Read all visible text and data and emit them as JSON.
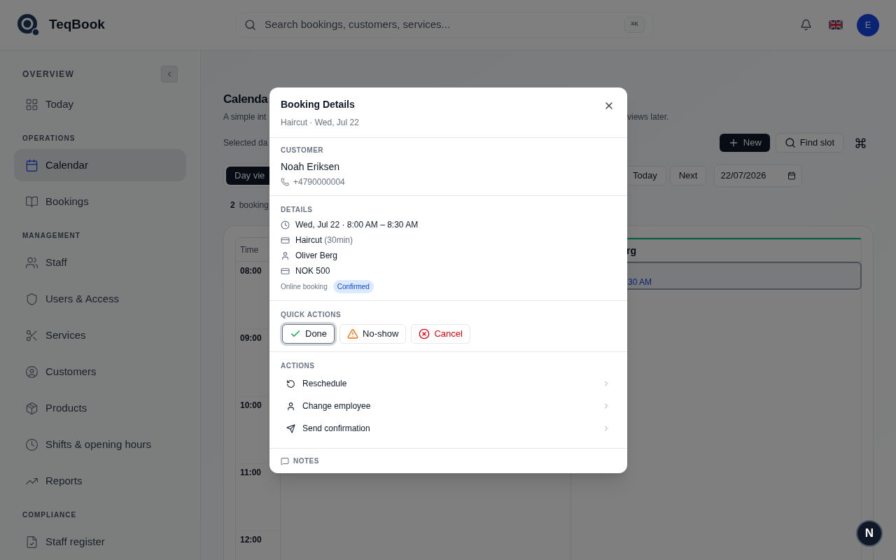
{
  "header": {
    "brand": "TeqBook",
    "search": {
      "placeholder": "Search bookings, customers, services..."
    },
    "shortcut": "⌘K",
    "avatar": "E"
  },
  "sidebar": {
    "sections": [
      {
        "label": "OVERVIEW",
        "items": [
          {
            "label": "Today",
            "selected": false
          }
        ]
      },
      {
        "label": "OPERATIONS",
        "items": [
          {
            "label": "Calendar",
            "selected": true
          },
          {
            "label": "Bookings",
            "selected": false
          }
        ]
      },
      {
        "label": "MANAGEMENT",
        "items": [
          {
            "label": "Staff",
            "selected": false
          },
          {
            "label": "Users & Access",
            "selected": false
          },
          {
            "label": "Services",
            "selected": false
          },
          {
            "label": "Customers",
            "selected": false
          },
          {
            "label": "Products",
            "selected": false
          },
          {
            "label": "Shifts & opening hours",
            "selected": false
          },
          {
            "label": "Reports",
            "selected": false
          }
        ]
      },
      {
        "label": "COMPLIANCE",
        "items": [
          {
            "label": "Staff register",
            "selected": false
          }
        ]
      }
    ]
  },
  "page": {
    "title": "Calenda",
    "subtitle_start": "A simple int",
    "subtitle_end": "views later.",
    "selected_date": "Selected da",
    "new_button": "New",
    "find_slot_button": "Find slot",
    "view_button": "Day vie",
    "today_button": "Today",
    "next_button": "Next",
    "date_value": "22/07/2026",
    "count": "2",
    "count_label": "booking",
    "calendar": {
      "time_header": "Time",
      "column_header": "rg",
      "times": [
        "08:00",
        "09:00",
        "10:00",
        "11:00",
        "12:00"
      ],
      "event_time": "30 AM"
    }
  },
  "dialog": {
    "title": "Booking Details",
    "subtitle": "Haircut · Wed, Jul 22",
    "customer": {
      "label": "CUSTOMER",
      "name": "Noah Eriksen",
      "phone": "+4790000004"
    },
    "details": {
      "label": "DETAILS",
      "rows": [
        {
          "kind": "time",
          "text": "Wed, Jul 22 · 8:00 AM – 8:30 AM"
        },
        {
          "kind": "service",
          "text": "Haircut",
          "note": "(30min)"
        },
        {
          "kind": "employee",
          "text": "Oliver Berg"
        },
        {
          "kind": "price",
          "text": "NOK 500"
        }
      ],
      "source": "Online booking",
      "status": "Confirmed"
    },
    "quick_actions": {
      "label": "QUICK ACTIONS",
      "buttons": [
        {
          "kind": "done",
          "label": "Done",
          "focused": true
        },
        {
          "kind": "noshow",
          "label": "No-show",
          "focused": false
        },
        {
          "kind": "cancel",
          "label": "Cancel",
          "focused": false
        }
      ]
    },
    "actions": {
      "label": "ACTIONS",
      "items": [
        {
          "kind": "reschedule",
          "label": "Reschedule"
        },
        {
          "kind": "employee",
          "label": "Change employee"
        },
        {
          "kind": "send",
          "label": "Send confirmation"
        }
      ]
    },
    "notes_label": "NOTES"
  },
  "dev_badge": "N"
}
